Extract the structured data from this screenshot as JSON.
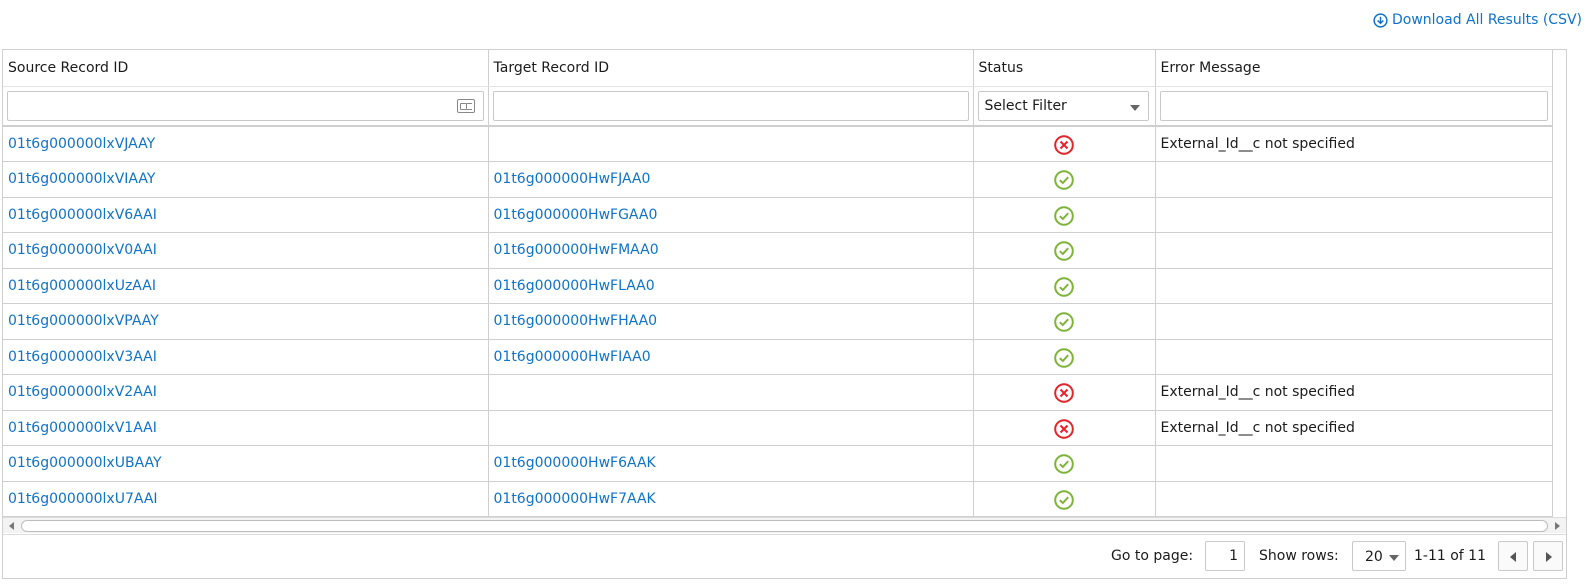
{
  "toolbar": {
    "download_label": "Download All Results (CSV)"
  },
  "columns": [
    {
      "label": "Source Record ID"
    },
    {
      "label": "Target Record ID"
    },
    {
      "label": "Status"
    },
    {
      "label": "Error Message"
    }
  ],
  "filters": {
    "status_select": "Select Filter"
  },
  "colors": {
    "link": "#0f73c6",
    "success": "#7fb33a",
    "error": "#e3242b"
  },
  "rows": [
    {
      "source": "01t6g000000lxVJAAY",
      "target": "",
      "status": "error",
      "status_icon": "error-x-circle-icon",
      "error": "External_Id__c not specified"
    },
    {
      "source": "01t6g000000lxVIAAY",
      "target": "01t6g000000HwFJAA0",
      "status": "success",
      "status_icon": "success-check-circle-icon",
      "error": ""
    },
    {
      "source": "01t6g000000lxV6AAI",
      "target": "01t6g000000HwFGAA0",
      "status": "success",
      "status_icon": "success-check-circle-icon",
      "error": ""
    },
    {
      "source": "01t6g000000lxV0AAI",
      "target": "01t6g000000HwFMAA0",
      "status": "success",
      "status_icon": "success-check-circle-icon",
      "error": ""
    },
    {
      "source": "01t6g000000lxUzAAI",
      "target": "01t6g000000HwFLAA0",
      "status": "success",
      "status_icon": "success-check-circle-icon",
      "error": ""
    },
    {
      "source": "01t6g000000lxVPAAY",
      "target": "01t6g000000HwFHAA0",
      "status": "success",
      "status_icon": "success-check-circle-icon",
      "error": ""
    },
    {
      "source": "01t6g000000lxV3AAI",
      "target": "01t6g000000HwFIAA0",
      "status": "success",
      "status_icon": "success-check-circle-icon",
      "error": ""
    },
    {
      "source": "01t6g000000lxV2AAI",
      "target": "",
      "status": "error",
      "status_icon": "error-x-circle-icon",
      "error": "External_Id__c not specified"
    },
    {
      "source": "01t6g000000lxV1AAI",
      "target": "",
      "status": "error",
      "status_icon": "error-x-circle-icon",
      "error": "External_Id__c not specified"
    },
    {
      "source": "01t6g000000lxUBAAY",
      "target": "01t6g000000HwF6AAK",
      "status": "success",
      "status_icon": "success-check-circle-icon",
      "error": ""
    },
    {
      "source": "01t6g000000lxU7AAI",
      "target": "01t6g000000HwF7AAK",
      "status": "success",
      "status_icon": "success-check-circle-icon",
      "error": ""
    }
  ],
  "pager": {
    "goto_label": "Go to page:",
    "page_value": "1",
    "rows_label": "Show rows:",
    "rows_value": "20",
    "range_text": "1-11 of 11"
  }
}
